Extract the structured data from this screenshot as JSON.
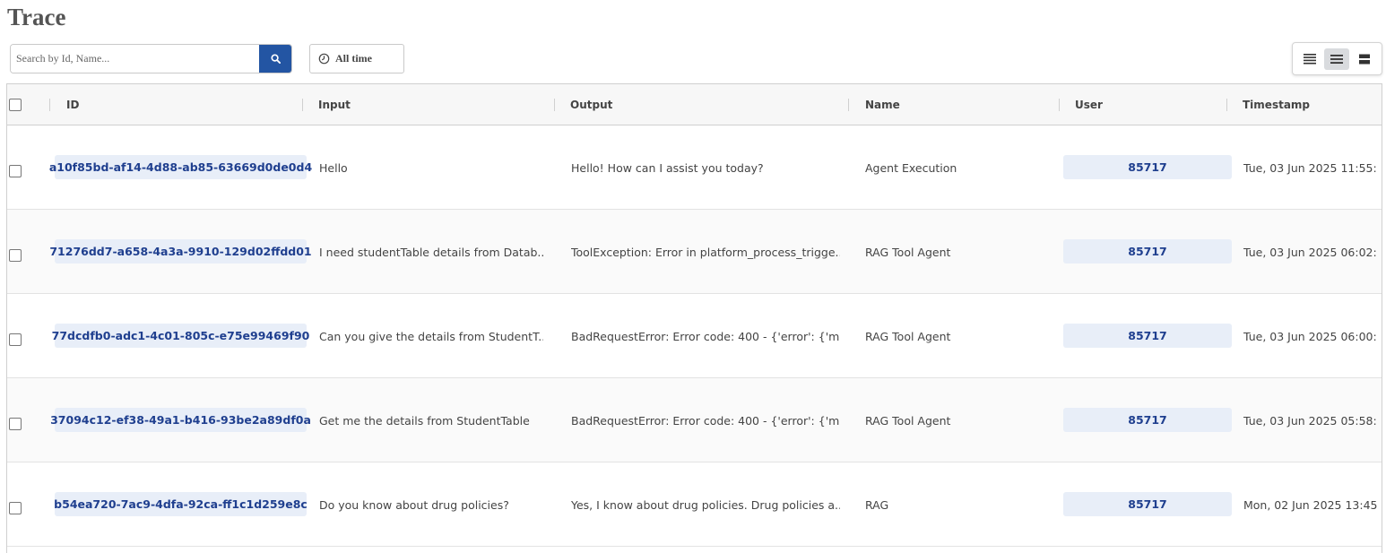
{
  "page": {
    "title": "Trace"
  },
  "search": {
    "placeholder": "Search by Id, Name...",
    "value": "",
    "button_icon": "search-icon"
  },
  "time_filter": {
    "label": "All time",
    "icon": "clock-icon"
  },
  "density": {
    "options": [
      "compact",
      "standard",
      "comfortable"
    ],
    "selected": "standard"
  },
  "table": {
    "columns": [
      "ID",
      "Input",
      "Output",
      "Name",
      "User",
      "Timestamp"
    ],
    "rows": [
      {
        "id": "a10f85bd-af14-4d88-ab85-63669d0de0d4",
        "input": "Hello",
        "output": "Hello! How can I assist you today?",
        "name": "Agent Execution",
        "user": "85717",
        "timestamp": "Tue, 03 Jun 2025 11:55:..."
      },
      {
        "id": "71276dd7-a658-4a3a-9910-129d02ffdd01",
        "input": "I need studentTable details from Datab...",
        "output": "ToolException: Error in platform_process_trigge...",
        "name": "RAG Tool Agent",
        "user": "85717",
        "timestamp": "Tue, 03 Jun 2025 06:02:..."
      },
      {
        "id": "77dcdfb0-adc1-4c01-805c-e75e99469f90",
        "input": "Can you give the details from StudentT...",
        "output": "BadRequestError: Error code: 400 - {'error': {'m...",
        "name": "RAG Tool Agent",
        "user": "85717",
        "timestamp": "Tue, 03 Jun 2025 06:00:..."
      },
      {
        "id": "37094c12-ef38-49a1-b416-93be2a89df0a",
        "input": "Get me the details from StudentTable",
        "output": "BadRequestError: Error code: 400 - {'error': {'m...",
        "name": "RAG Tool Agent",
        "user": "85717",
        "timestamp": "Tue, 03 Jun 2025 05:58:..."
      },
      {
        "id": "b54ea720-7ac9-4dfa-92ca-ff1c1d259e8c",
        "input": "Do you know about drug policies?",
        "output": "Yes, I know about drug policies. Drug policies a...",
        "name": "RAG",
        "user": "85717",
        "timestamp": "Mon, 02 Jun 2025 13:45..."
      }
    ]
  }
}
